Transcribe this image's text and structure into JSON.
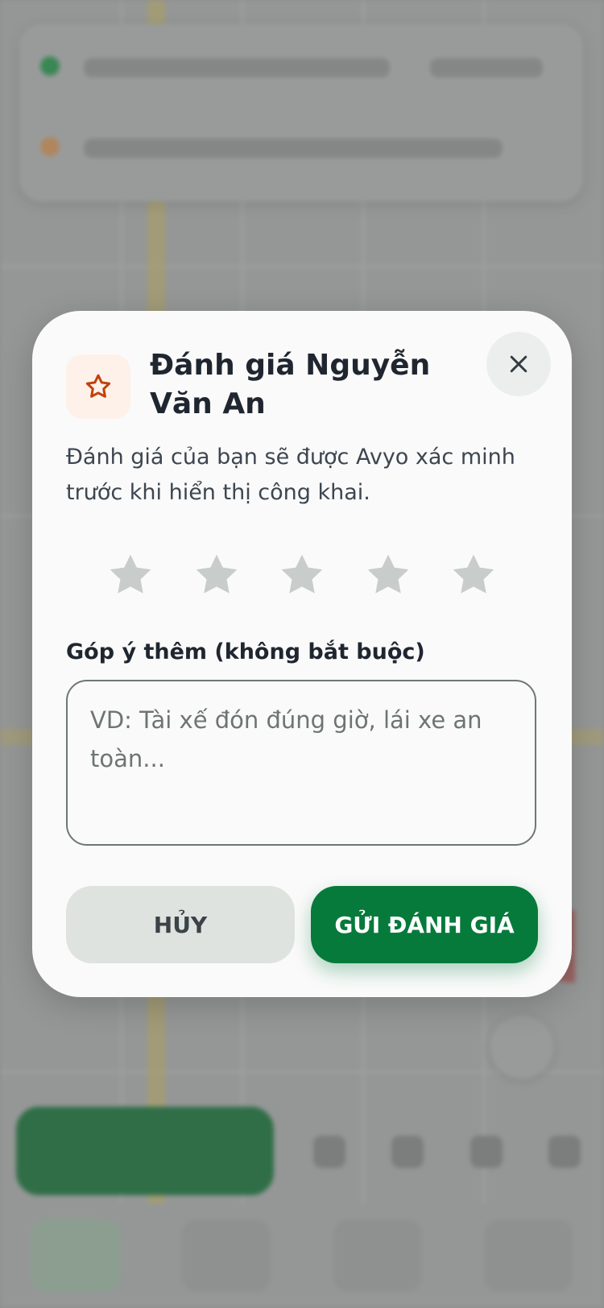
{
  "modal": {
    "title": "Đánh giá Nguyễn Văn An",
    "subtitle": "Đánh giá của bạn sẽ được Avyo xác minh trước khi hiển thị công khai.",
    "rating": {
      "max": 5,
      "value": 0
    },
    "comment_label": "Góp ý thêm (không bắt buộc)",
    "comment_placeholder": "VD: Tài xế đón đúng giờ, lái xe an toàn...",
    "cancel_label": "HỦY",
    "submit_label": "GỬI ĐÁNH GIÁ"
  },
  "icons": {
    "header": "star-outline-icon",
    "close": "close-icon",
    "rating": "star-icon"
  },
  "colors": {
    "primary_green": "#067a3b",
    "star_inactive": "#c8cccb",
    "header_icon_stroke": "#c2410c",
    "header_icon_bg": "#fdf1e9"
  }
}
